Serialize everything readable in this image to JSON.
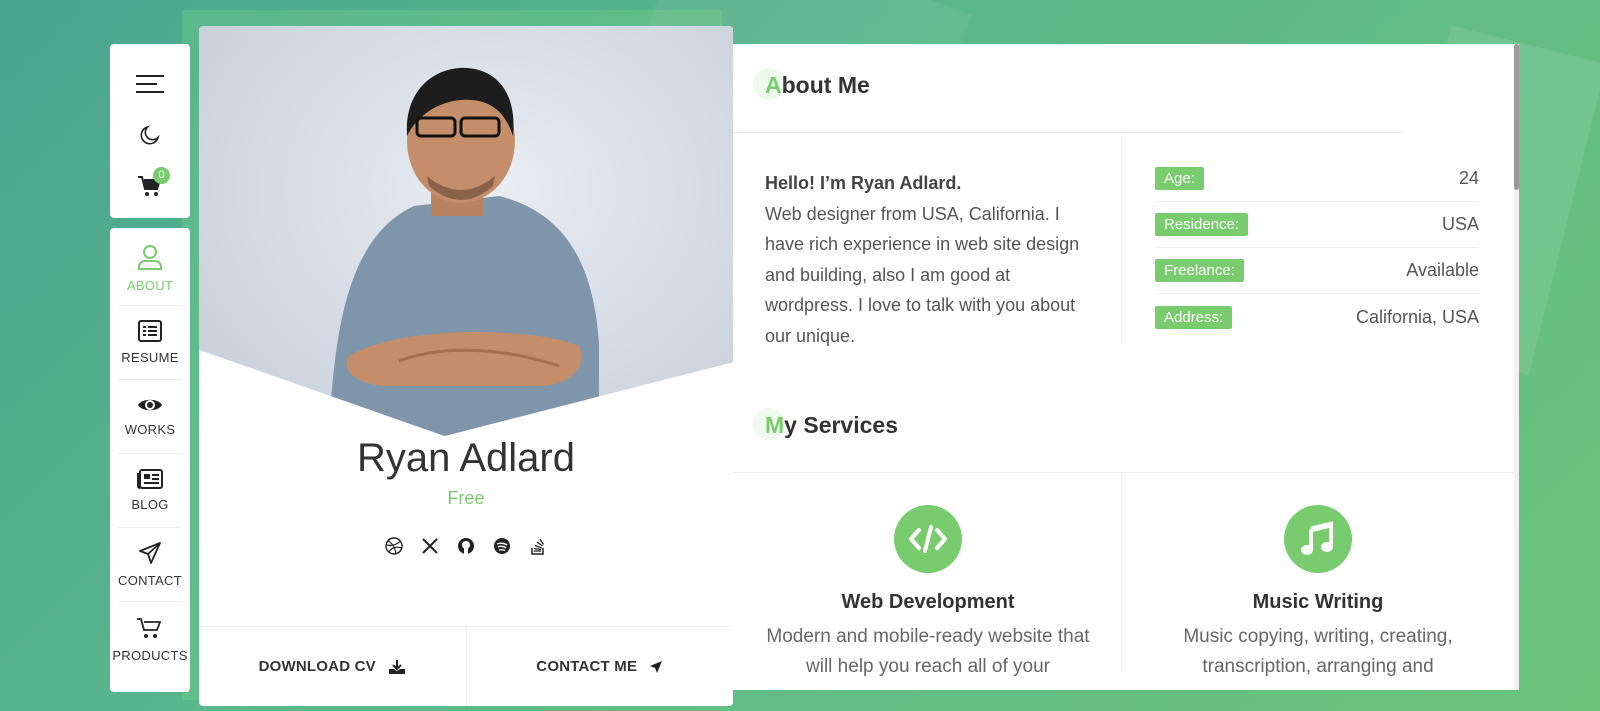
{
  "cart": {
    "count": "0"
  },
  "nav": {
    "items": [
      {
        "label": "ABOUT",
        "icon": "user-icon"
      },
      {
        "label": "RESUME",
        "icon": "list-icon"
      },
      {
        "label": "WORKS",
        "icon": "eye-icon"
      },
      {
        "label": "BLOG",
        "icon": "newspaper-icon"
      },
      {
        "label": "CONTACT",
        "icon": "send-icon"
      },
      {
        "label": "PRODUCTS",
        "icon": "cart-icon"
      }
    ]
  },
  "profile": {
    "name": "Ryan Adlard",
    "status": "Free",
    "socials": [
      "dribbble-icon",
      "x-icon",
      "github-icon",
      "spotify-icon",
      "stackoverflow-icon"
    ],
    "download_label": "DOWNLOAD CV",
    "contact_label": "CONTACT ME"
  },
  "about": {
    "title_first": "A",
    "title_rest": "bout Me",
    "hello": "Hello! I’m Ryan Adlard.",
    "bio": "Web designer from USA, California. I have rich experience in web site design and building, also I am good at wordpress. I love to talk with you about our unique.",
    "info": [
      {
        "label": "Age:",
        "value": "24"
      },
      {
        "label": "Residence:",
        "value": "USA"
      },
      {
        "label": "Freelance:",
        "value": "Available"
      },
      {
        "label": "Address:",
        "value": "California, USA"
      }
    ]
  },
  "services": {
    "title_first": "M",
    "title_rest": "y Services",
    "items": [
      {
        "title": "Web Development",
        "desc": "Modern and mobile-ready website that will help you reach all of your",
        "icon": "code-icon"
      },
      {
        "title": "Music Writing",
        "desc": "Music copying, writing, creating, transcription, arranging and",
        "icon": "music-note-icon"
      }
    ]
  },
  "colors": {
    "accent": "#78cc6d",
    "background": "#5cb88a"
  }
}
